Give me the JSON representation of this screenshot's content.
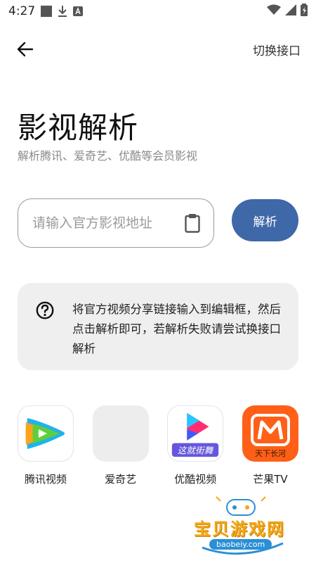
{
  "status_bar": {
    "time": "4:27"
  },
  "toolbar": {
    "switch_label": "切换接口"
  },
  "header": {
    "title": "影视解析",
    "subtitle": "解析腾讯、爱奇艺、优酷等会员影视"
  },
  "input": {
    "placeholder": "请输入官方影视地址",
    "value": ""
  },
  "parse_button": {
    "label": "解析"
  },
  "tip": {
    "text": "将官方视频分享链接输入到编辑框，然后点击解析即可，若解析失败请尝试换接口解析"
  },
  "platforms": [
    {
      "label": "腾讯视频"
    },
    {
      "label": "爱奇艺"
    },
    {
      "label": "优酷视频"
    },
    {
      "label": "芒果TV"
    }
  ],
  "youku_logo_text": "这就街舞",
  "mango_logo_text": "天下长河",
  "watermark": {
    "title": "宝贝游戏网",
    "url": "baobeiy.com"
  },
  "colors": {
    "accent": "#3f68a8",
    "card_bg": "#efefef",
    "mango": "#ff5f16"
  }
}
